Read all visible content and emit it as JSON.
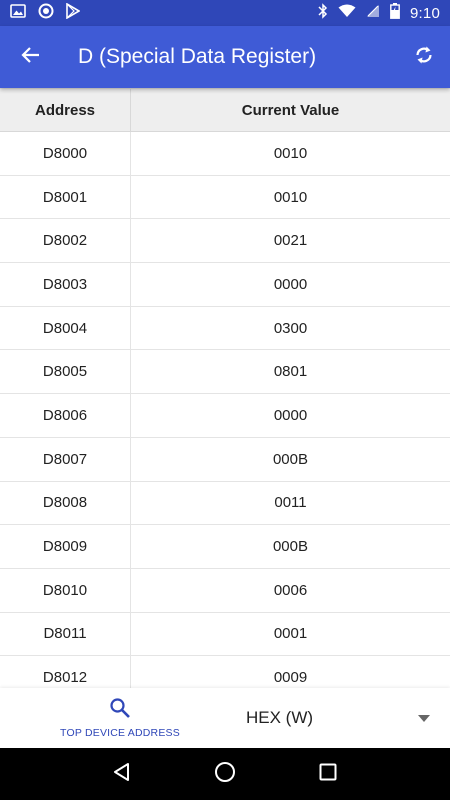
{
  "status_bar": {
    "time": "9:10",
    "left_icons": [
      "image-icon",
      "circle-notification-icon",
      "play-store-icon"
    ],
    "right_icons": [
      "bluetooth-icon",
      "wifi-icon",
      "no-sim-icon",
      "battery-charging-icon"
    ]
  },
  "app_bar": {
    "title": "D (Special Data Register)",
    "back_icon": "arrow-back-icon",
    "refresh_icon": "refresh-icon",
    "color": "#3f5bd6"
  },
  "table": {
    "headers": {
      "address": "Address",
      "value": "Current Value"
    },
    "rows": [
      {
        "address": "D8000",
        "value": "0010"
      },
      {
        "address": "D8001",
        "value": "0010"
      },
      {
        "address": "D8002",
        "value": "0021"
      },
      {
        "address": "D8003",
        "value": "0000"
      },
      {
        "address": "D8004",
        "value": "0300"
      },
      {
        "address": "D8005",
        "value": "0801"
      },
      {
        "address": "D8006",
        "value": "0000"
      },
      {
        "address": "D8007",
        "value": "000B"
      },
      {
        "address": "D8008",
        "value": "0011"
      },
      {
        "address": "D8009",
        "value": "000B"
      },
      {
        "address": "D8010",
        "value": "0006"
      },
      {
        "address": "D8011",
        "value": "0001"
      },
      {
        "address": "D8012",
        "value": "0009"
      }
    ]
  },
  "bottom_bar": {
    "top_device_label": "TOP DEVICE ADDRESS",
    "format_selected": "HEX (W)",
    "accent": "#2f47b8"
  },
  "nav_bar": {
    "buttons": [
      "back-triangle-icon",
      "home-circle-icon",
      "recents-square-icon"
    ]
  }
}
